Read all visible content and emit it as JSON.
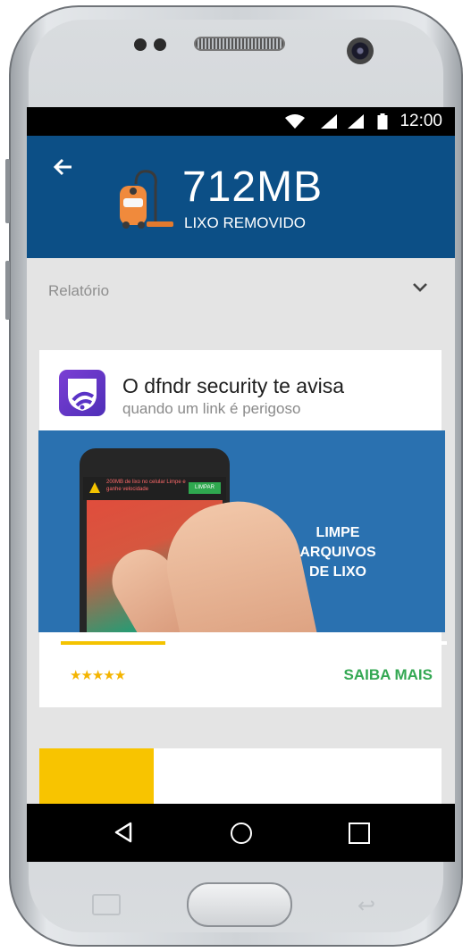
{
  "status_bar": {
    "time": "12:00"
  },
  "app_bar": {
    "cleaned_amount": "712MB",
    "cleaned_label": "LIXO REMOVIDO"
  },
  "report": {
    "label": "Relatório"
  },
  "ad": {
    "title": "O dfndr security te avisa",
    "subtitle": "quando um link é perigoso",
    "media_notification": "200MB de lixo no celular Limpe e ganhe velocidade",
    "media_notification_button": "LIMPAR",
    "media_headline": [
      "LIMPE",
      "ARQUIVOS",
      "DE LIXO"
    ],
    "rating": 4.5,
    "stars": "★★★★★",
    "cta_label": "SAIBA MAIS",
    "video_progress": 0.27
  },
  "colors": {
    "app_bar": "#0c4f86",
    "cta": "#34a853",
    "stars": "#f4b400",
    "progress": "#f4c300"
  },
  "nav_bar": {
    "icons": [
      "back-icon",
      "home-icon",
      "recent-apps-icon"
    ]
  }
}
